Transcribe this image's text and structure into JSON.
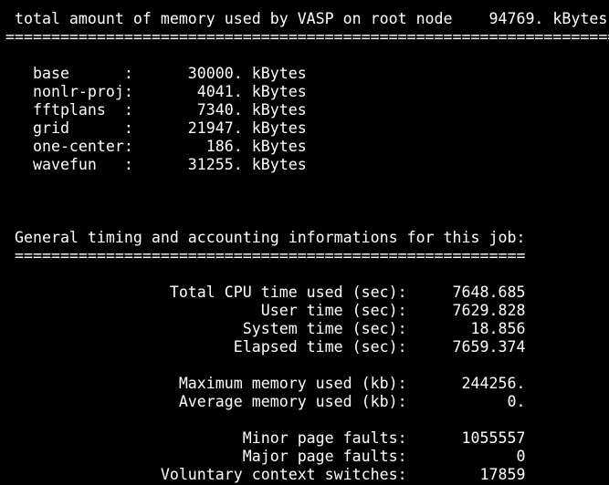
{
  "terminal": {
    "background_color": "#000000",
    "text_color": "#ffffff",
    "lines": [
      " total amount of memory used by VASP on root node    94769. kBytes",
      "========================================================================",
      "",
      "   base      :      30000. kBytes",
      "   nonlr-proj:       4041. kBytes",
      "   fftplans  :       7340. kBytes",
      "   grid      :      21947. kBytes",
      "   one-center:        186. kBytes",
      "   wavefun   :      31255. kBytes",
      "",
      "",
      "",
      " General timing and accounting informations for this job:",
      " ========================================================",
      "",
      "                  Total CPU time used (sec):     7648.685",
      "                            User time (sec):     7629.828",
      "                          System time (sec):       18.856",
      "                         Elapsed time (sec):     7659.374",
      "",
      "                   Maximum memory used (kb):      244256.",
      "                   Average memory used (kb):           0.",
      "",
      "                          Minor page faults:      1055557",
      "                          Major page faults:            0",
      "                 Voluntary context switches:        17859"
    ]
  }
}
